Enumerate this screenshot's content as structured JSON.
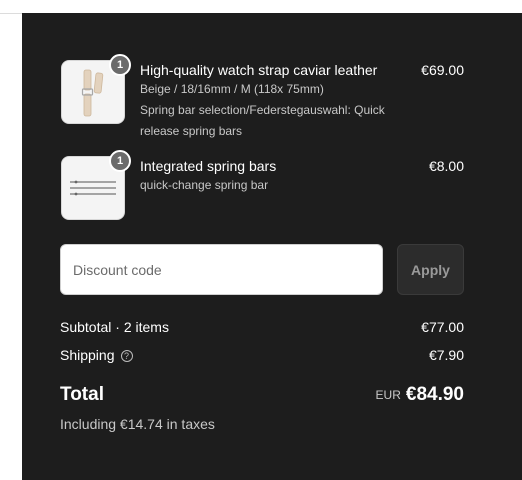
{
  "items": [
    {
      "name": "High-quality watch strap caviar leather",
      "variant": "Beige / 18/16mm / M (118x 75mm)",
      "option_line1": "Spring bar selection/Federstegauswahl: Quick",
      "option_line2": "release spring bars",
      "price": "€69.00",
      "quantity": "1",
      "thumb_icon": "watch-strap-icon"
    },
    {
      "name": "Integrated spring bars",
      "variant": "quick-change spring bar",
      "price": "€8.00",
      "quantity": "1",
      "thumb_icon": "spring-bars-icon"
    }
  ],
  "discount": {
    "placeholder": "Discount code",
    "apply_label": "Apply"
  },
  "subtotal": {
    "label": "Subtotal · 2 items",
    "value": "€77.00"
  },
  "shipping": {
    "label": "Shipping",
    "value": "€7.90",
    "icon": "help-icon"
  },
  "total": {
    "label": "Total",
    "currency": "EUR",
    "value": "€84.90"
  },
  "taxes_note": "Including €14.74 in taxes",
  "colors": {
    "panel_bg": "#1d1d1d",
    "text": "#ffffff",
    "muted_text": "#c8c8c8",
    "badge": "#6b6b6b"
  }
}
